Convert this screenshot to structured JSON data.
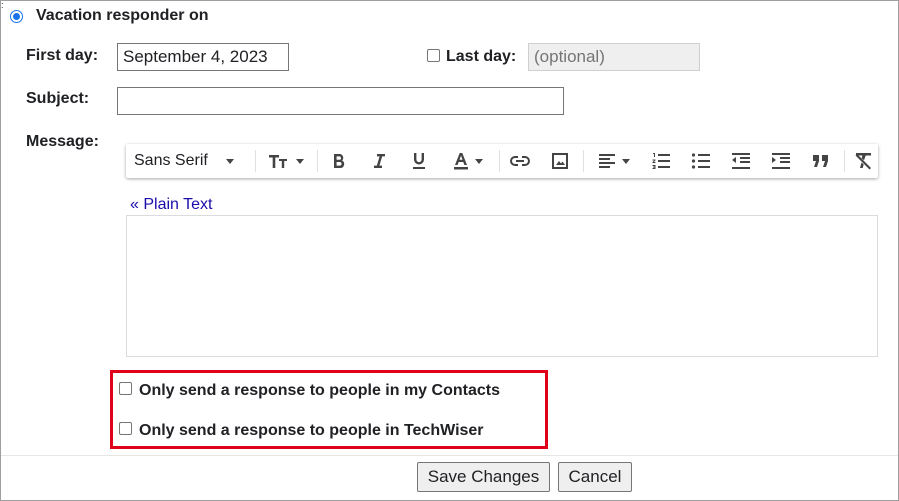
{
  "responder": {
    "label": "Vacation responder on"
  },
  "first_day": {
    "label": "First day:",
    "value": "September 4, 2023"
  },
  "last_day": {
    "label": "Last day:",
    "placeholder": "(optional)"
  },
  "subject": {
    "label": "Subject:",
    "value": ""
  },
  "message": {
    "label": "Message:",
    "plain_text_link": "« Plain Text"
  },
  "toolbar": {
    "font_name": "Sans Serif",
    "icons": [
      "font-size-icon",
      "bold-icon",
      "italic-icon",
      "underline-icon",
      "text-color-icon",
      "link-icon",
      "image-icon",
      "align-icon",
      "numbered-list-icon",
      "bulleted-list-icon",
      "indent-less-icon",
      "indent-more-icon",
      "quote-icon",
      "remove-formatting-icon"
    ]
  },
  "options": {
    "contacts_only": "Only send a response to people in my Contacts",
    "org_only": "Only send a response to people in TechWiser"
  },
  "buttons": {
    "save": "Save Changes",
    "cancel": "Cancel"
  },
  "colors": {
    "accent": "#1a73e8",
    "highlight_border": "#e0001a",
    "link": "#1a0dab"
  }
}
